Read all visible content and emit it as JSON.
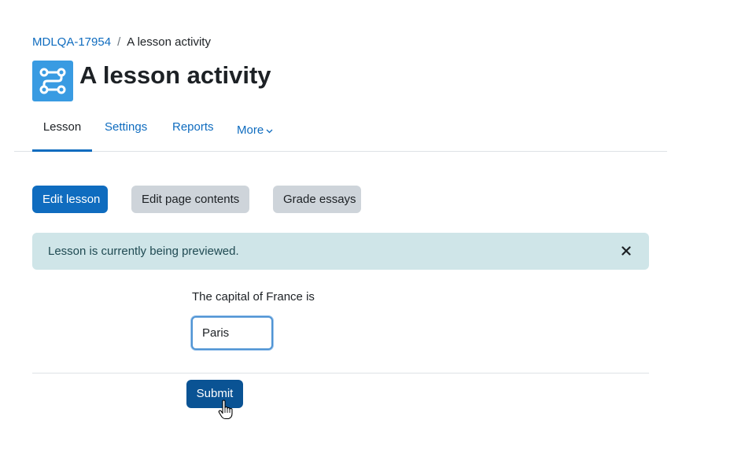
{
  "breadcrumb": {
    "course": "MDLQA-17954",
    "separator": "/",
    "current": "A lesson activity"
  },
  "header": {
    "icon": "lesson-icon",
    "title": "A lesson activity"
  },
  "tabs": [
    {
      "label": "Lesson",
      "active": true
    },
    {
      "label": "Settings",
      "active": false
    },
    {
      "label": "Reports",
      "active": false
    },
    {
      "label": "More",
      "active": false
    }
  ],
  "actions": {
    "edit_lesson": "Edit lesson",
    "edit_page_contents": "Edit page contents",
    "grade_essays": "Grade essays"
  },
  "alert": {
    "message": "Lesson is currently being previewed.",
    "close_icon": "close-icon"
  },
  "question": {
    "text": "The capital of France is",
    "answer_value": "Paris"
  },
  "submit_label": "Submit",
  "colors": {
    "primary": "#0f6cbf",
    "secondary": "#ced4da",
    "alert_bg": "#cfe5e8",
    "icon_bg": "#399be2"
  }
}
